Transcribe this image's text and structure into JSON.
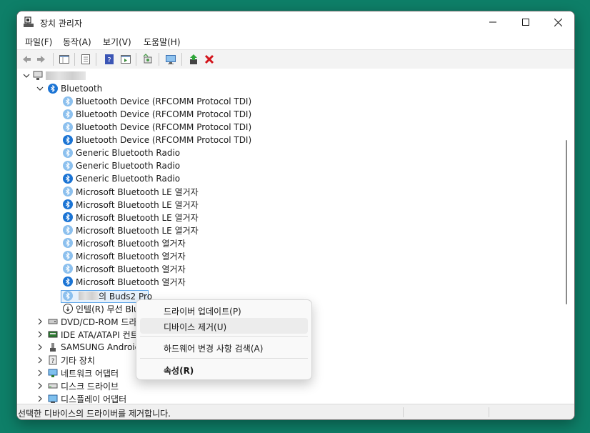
{
  "window": {
    "title": "장치 관리자"
  },
  "menu": [
    "파일(F)",
    "동작(A)",
    "보기(V)",
    "도움말(H)"
  ],
  "toolbar_icons": [
    "back-arrow-icon",
    "forward-arrow-icon",
    "properties-pane-icon",
    "properties-icon",
    "help-icon",
    "show-hidden-icon",
    "scan-hardware-icon",
    "monitor-icon",
    "update-driver-icon",
    "uninstall-x-icon"
  ],
  "tree": {
    "bluetooth_category": "Bluetooth",
    "bluetooth_devices": [
      {
        "label": "Bluetooth Device (RFCOMM Protocol TDI)",
        "style": "light"
      },
      {
        "label": "Bluetooth Device (RFCOMM Protocol TDI)",
        "style": "light"
      },
      {
        "label": "Bluetooth Device (RFCOMM Protocol TDI)",
        "style": "light"
      },
      {
        "label": "Bluetooth Device (RFCOMM Protocol TDI)",
        "style": "dark"
      },
      {
        "label": "Generic Bluetooth Radio",
        "style": "light"
      },
      {
        "label": "Generic Bluetooth Radio",
        "style": "light"
      },
      {
        "label": "Generic Bluetooth Radio",
        "style": "dark"
      },
      {
        "label": "Microsoft Bluetooth LE 열거자",
        "style": "light"
      },
      {
        "label": "Microsoft Bluetooth LE 열거자",
        "style": "dark"
      },
      {
        "label": "Microsoft Bluetooth LE 열거자",
        "style": "dark"
      },
      {
        "label": "Microsoft Bluetooth LE 열거자",
        "style": "light"
      },
      {
        "label": "Microsoft Bluetooth 열거자",
        "style": "light"
      },
      {
        "label": "Microsoft Bluetooth 열거자",
        "style": "light"
      },
      {
        "label": "Microsoft Bluetooth 열거자",
        "style": "light"
      },
      {
        "label": "Microsoft Bluetooth 열거자",
        "style": "dark"
      }
    ],
    "selected_device": "의 Buds2 Pro",
    "intel_device": "인텔(R) 무선 Blu",
    "categories": [
      "DVD/CD-ROM 드라",
      "IDE ATA/ATAPI 컨트",
      "SAMSUNG Android",
      "기타 장치",
      "네트워크 어댑터",
      "디스크 드라이브",
      "디스플레이 어댑터"
    ]
  },
  "context_menu": {
    "update_driver": "드라이버 업데이트(P)",
    "uninstall_device": "디바이스 제거(U)",
    "scan_changes": "하드웨어 변경 사항 검색(A)",
    "properties": "속성(R)"
  },
  "status": {
    "text": "선택한 디바이스의 드라이버를 제거합니다."
  }
}
